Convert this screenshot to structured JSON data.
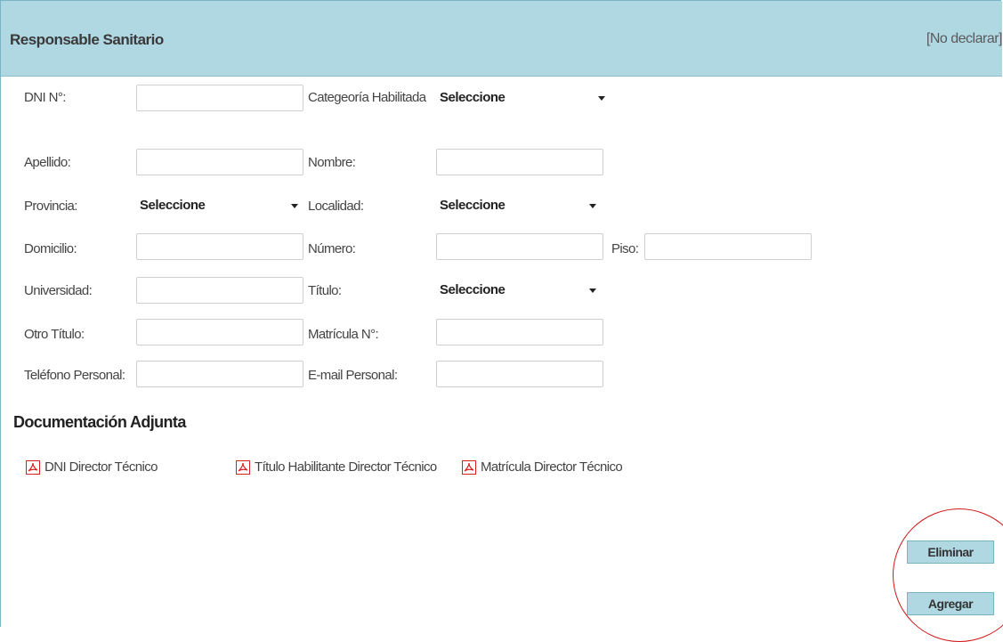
{
  "header": {
    "title": "Responsable Sanitario",
    "no_declarar": "[No declarar]"
  },
  "form": {
    "dni_label": "DNI N°:",
    "categoria_label": "Categeoría Habilitada",
    "categoria_value": "Seleccione",
    "apellido_label": "Apellido:",
    "nombre_label": "Nombre:",
    "provincia_label": "Provincia:",
    "provincia_value": "Seleccione",
    "localidad_label": "Localidad:",
    "localidad_value": "Seleccione",
    "domicilio_label": "Domicilio:",
    "numero_label": "Número:",
    "piso_label": "Piso:",
    "universidad_label": "Universidad:",
    "titulo_label": "Título:",
    "titulo_value": "Seleccione",
    "otro_titulo_label": "Otro Título:",
    "matricula_label": "Matrícula N°:",
    "telefono_label": "Teléfono Personal:",
    "email_label": "E-mail Personal:"
  },
  "documentation": {
    "title": "Documentación Adjunta",
    "items": [
      {
        "label": "DNI Director Técnico",
        "icon": "pdf-icon"
      },
      {
        "label": "Título Habilitante Director Técnico",
        "icon": "pdf-icon"
      },
      {
        "label": "Matrícula Director Técnico",
        "icon": "pdf-icon"
      }
    ]
  },
  "actions": {
    "eliminar_label": "Eliminar",
    "agregar_label": "Agregar"
  },
  "colors": {
    "header_bg": "#b0d8e3",
    "button_bg": "#b0d8e3",
    "annotation_circle": "#d01818",
    "pdf_icon": "#d42020"
  }
}
